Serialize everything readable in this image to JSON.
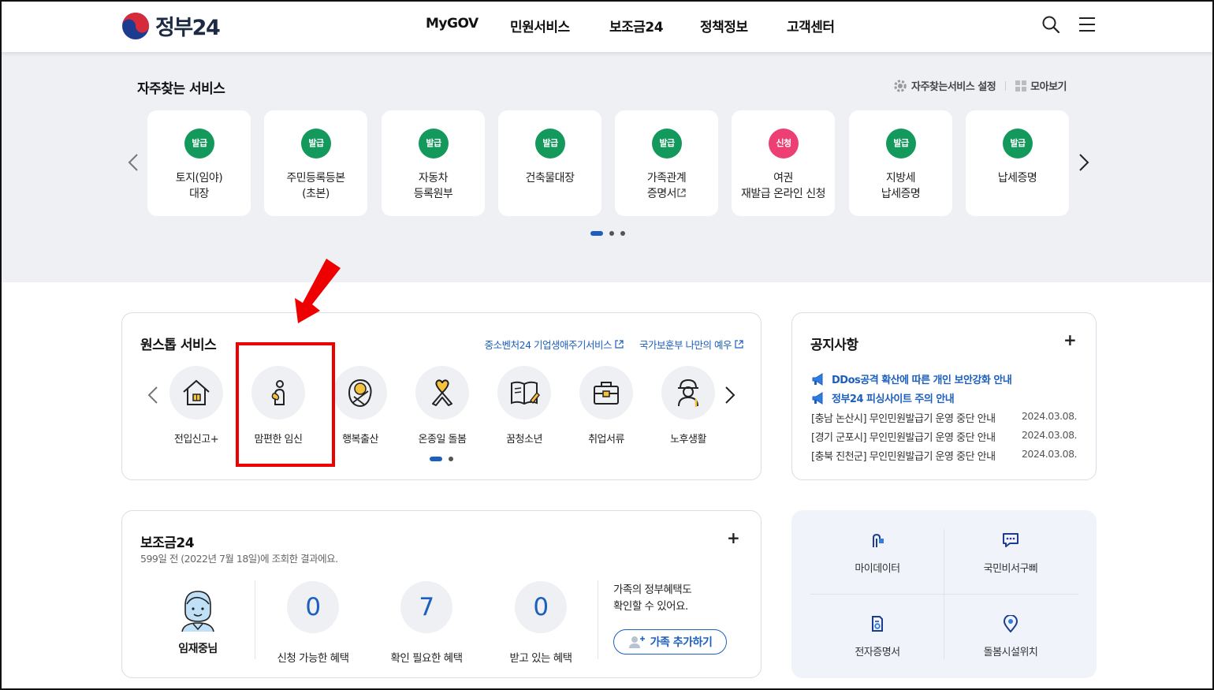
{
  "header": {
    "logo_text": "정부24",
    "nav": [
      "MyGOV",
      "민원서비스",
      "보조금24",
      "정책정보",
      "고객센터"
    ],
    "icons": [
      "search-icon",
      "menu-icon"
    ]
  },
  "favorites": {
    "title": "자주찾는 서비스",
    "settings_label": "자주찾는서비스 설정",
    "viewall_label": "모아보기",
    "cards": [
      {
        "badge": "발급",
        "label": "토지(임야)\n대장"
      },
      {
        "badge": "발급",
        "label": "주민등록등본\n(초본)"
      },
      {
        "badge": "발급",
        "label": "자동차\n등록원부"
      },
      {
        "badge": "발급",
        "label": "건축물대장"
      },
      {
        "badge": "발급",
        "label": "가족관계\n증명서"
      },
      {
        "badge": "신청",
        "label": "여권\n재발급 온라인 신청"
      },
      {
        "badge": "발급",
        "label": "지방세\n납세증명"
      },
      {
        "badge": "발급",
        "label": "납세증명"
      }
    ]
  },
  "onestop": {
    "title": "원스톱 서비스",
    "links": [
      "중소벤처24 기업생애주기서비스",
      "국가보훈부 나만의 예우"
    ],
    "items": [
      {
        "label": "전입신고+",
        "icon": "house-icon"
      },
      {
        "label": "맘편한 임신",
        "icon": "pregnancy-icon"
      },
      {
        "label": "행복출산",
        "icon": "baby-icon"
      },
      {
        "label": "온종일 돌봄",
        "icon": "ribbon-icon"
      },
      {
        "label": "꿈청소년",
        "icon": "book-icon"
      },
      {
        "label": "취업서류",
        "icon": "briefcase-icon"
      },
      {
        "label": "노후생활",
        "icon": "elder-icon"
      }
    ]
  },
  "notice": {
    "title": "공지사항",
    "plus": "+",
    "highlights": [
      "DDos공격 확산에 따른 개인 보안강화 안내",
      "정부24 피싱사이트 주의 안내"
    ],
    "rows": [
      {
        "title": "[충남 논산시] 무인민원발급기 운영 중단 안내",
        "date": "2024.03.08."
      },
      {
        "title": "[경기 군포시] 무인민원발급기 운영 중단 안내",
        "date": "2024.03.08."
      },
      {
        "title": "[충북 진천군] 무인민원발급기 운영 중단 안내",
        "date": "2024.03.08."
      }
    ]
  },
  "subsidy": {
    "title": "보조금24",
    "plus": "+",
    "note": "599일 전 (2022년 7월 18일)에 조회한 결과에요.",
    "user_name": "임재중님",
    "stats": [
      {
        "value": "0",
        "label": "신청 가능한 혜택"
      },
      {
        "value": "7",
        "label": "확인 필요한 혜택"
      },
      {
        "value": "0",
        "label": "받고 있는 혜택"
      }
    ],
    "family_text_1": "가족의 정부혜택도",
    "family_text_2": "확인할 수 있어요.",
    "family_button": "가족 추가하기"
  },
  "quick": {
    "items": [
      {
        "label": "마이데이터",
        "icon": "mydata-icon"
      },
      {
        "label": "국민비서구삐",
        "icon": "chat-icon"
      },
      {
        "label": "전자증명서",
        "icon": "document-icon"
      },
      {
        "label": "돌봄시설위치",
        "icon": "location-pin-icon"
      }
    ]
  },
  "colors": {
    "accent": "#1c5fbd",
    "badge_green": "#14995d",
    "badge_pink": "#ee3f74",
    "annotation": "#ee0000"
  }
}
